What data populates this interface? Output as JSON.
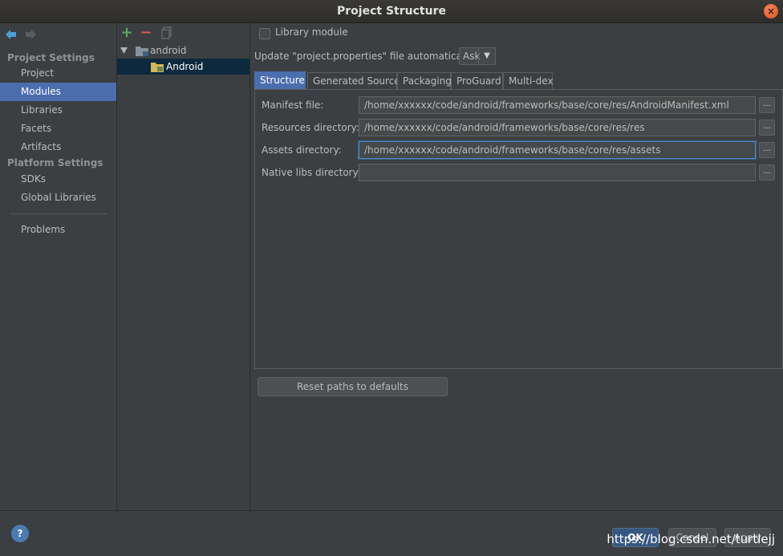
{
  "window": {
    "title": "Project Structure",
    "close_glyph": "×"
  },
  "sidebar": {
    "project_settings_heading": "Project Settings",
    "project_items": [
      {
        "label": "Project"
      },
      {
        "label": "Modules",
        "selected": true
      },
      {
        "label": "Libraries"
      },
      {
        "label": "Facets"
      },
      {
        "label": "Artifacts"
      }
    ],
    "platform_settings_heading": "Platform Settings",
    "platform_items": [
      {
        "label": "SDKs"
      },
      {
        "label": "Global Libraries"
      }
    ],
    "problems_label": "Problems"
  },
  "tree": {
    "toolbar": {
      "add_glyph": "+",
      "remove_glyph": "−"
    },
    "nodes": [
      {
        "label": "android",
        "expanded": true
      },
      {
        "label": "Android",
        "selected": true
      }
    ]
  },
  "module": {
    "library_module_label": "Library module",
    "library_module_checked": false,
    "update_label": "Update \"project.properties\" file automatically:",
    "update_value": "Ask",
    "tabs": [
      {
        "label": "Structure",
        "active": true
      },
      {
        "label": "Generated Sources"
      },
      {
        "label": "Packaging"
      },
      {
        "label": "ProGuard"
      },
      {
        "label": "Multi-dex"
      }
    ],
    "fields": [
      {
        "label": "Manifest file:",
        "value": "/home/xxxxxx/code/android/frameworks/base/core/res/AndroidManifest.xml"
      },
      {
        "label": "Resources directory:",
        "value": "/home/xxxxxx/code/android/frameworks/base/core/res/res"
      },
      {
        "label": "Assets directory:",
        "value": "/home/xxxxxx/code/android/frameworks/base/core/res/assets"
      },
      {
        "label": "Native libs directory:",
        "value": ""
      }
    ],
    "browse_label": "...",
    "reset_label": "Reset paths to defaults"
  },
  "footer": {
    "help_glyph": "?",
    "ok_label": "OK",
    "cancel_label": "Cancel",
    "apply_label": "Apply",
    "watermark": "https://blog.csdn.net/turtlejj"
  },
  "colors": {
    "background": "#3c3f41",
    "selection": "#4b6eaf",
    "tree_selection": "#0d293e",
    "focus_border": "#4a88c7"
  }
}
